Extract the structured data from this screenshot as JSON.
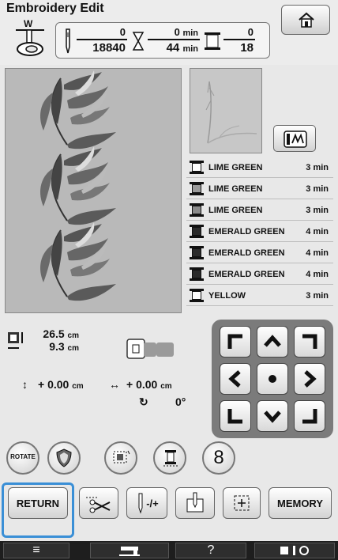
{
  "header": {
    "title": "Embroidery Edit",
    "presser_foot_label": "W"
  },
  "counters": {
    "stitch_current": "0",
    "stitch_total": "18840",
    "time_current": "0",
    "time_total": "44",
    "time_unit": "min",
    "color_current": "0",
    "color_total": "18"
  },
  "threads": [
    {
      "name": "LIME GREEN",
      "time": "3 min",
      "color": "#ffffff"
    },
    {
      "name": "LIME GREEN",
      "time": "3 min",
      "color": "#9a9a9a"
    },
    {
      "name": "LIME GREEN",
      "time": "3 min",
      "color": "#8a8a8a"
    },
    {
      "name": "EMERALD GREEN",
      "time": "4 min",
      "color": "#2a2a2a"
    },
    {
      "name": "EMERALD GREEN",
      "time": "4 min",
      "color": "#2a2a2a"
    },
    {
      "name": "EMERALD GREEN",
      "time": "4 min",
      "color": "#2a2a2a"
    },
    {
      "name": "YELLOW",
      "time": "3 min",
      "color": "#ffffff"
    }
  ],
  "size": {
    "height": "26.5",
    "width": "9.3",
    "unit": "cm"
  },
  "move": {
    "vertical": "+ 0.00",
    "horizontal": "+ 0.00",
    "unit": "cm",
    "rotation": "0°"
  },
  "edit_buttons": {
    "rotate": "ROTATE",
    "count": "8"
  },
  "bottom_buttons": {
    "return": "RETURN",
    "needle_label": "-/+",
    "memory": "MEMORY"
  },
  "footer": {
    "help": "?"
  },
  "icons": {
    "home": "home-icon",
    "hoop": "hoop-icon",
    "thread_spool": "thread-spool-icon"
  },
  "colors": {
    "highlight": "#3a8fd6"
  }
}
